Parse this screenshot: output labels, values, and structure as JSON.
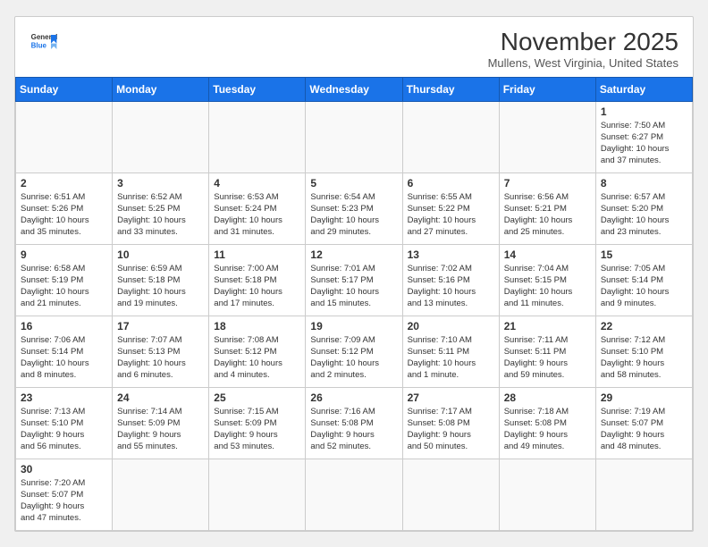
{
  "header": {
    "logo_line1": "General",
    "logo_line2": "Blue",
    "month": "November 2025",
    "location": "Mullens, West Virginia, United States"
  },
  "days_of_week": [
    "Sunday",
    "Monday",
    "Tuesday",
    "Wednesday",
    "Thursday",
    "Friday",
    "Saturday"
  ],
  "weeks": [
    [
      {
        "day": "",
        "info": ""
      },
      {
        "day": "",
        "info": ""
      },
      {
        "day": "",
        "info": ""
      },
      {
        "day": "",
        "info": ""
      },
      {
        "day": "",
        "info": ""
      },
      {
        "day": "",
        "info": ""
      },
      {
        "day": "1",
        "info": "Sunrise: 7:50 AM\nSunset: 6:27 PM\nDaylight: 10 hours\nand 37 minutes."
      }
    ],
    [
      {
        "day": "2",
        "info": "Sunrise: 6:51 AM\nSunset: 5:26 PM\nDaylight: 10 hours\nand 35 minutes."
      },
      {
        "day": "3",
        "info": "Sunrise: 6:52 AM\nSunset: 5:25 PM\nDaylight: 10 hours\nand 33 minutes."
      },
      {
        "day": "4",
        "info": "Sunrise: 6:53 AM\nSunset: 5:24 PM\nDaylight: 10 hours\nand 31 minutes."
      },
      {
        "day": "5",
        "info": "Sunrise: 6:54 AM\nSunset: 5:23 PM\nDaylight: 10 hours\nand 29 minutes."
      },
      {
        "day": "6",
        "info": "Sunrise: 6:55 AM\nSunset: 5:22 PM\nDaylight: 10 hours\nand 27 minutes."
      },
      {
        "day": "7",
        "info": "Sunrise: 6:56 AM\nSunset: 5:21 PM\nDaylight: 10 hours\nand 25 minutes."
      },
      {
        "day": "8",
        "info": "Sunrise: 6:57 AM\nSunset: 5:20 PM\nDaylight: 10 hours\nand 23 minutes."
      }
    ],
    [
      {
        "day": "9",
        "info": "Sunrise: 6:58 AM\nSunset: 5:19 PM\nDaylight: 10 hours\nand 21 minutes."
      },
      {
        "day": "10",
        "info": "Sunrise: 6:59 AM\nSunset: 5:18 PM\nDaylight: 10 hours\nand 19 minutes."
      },
      {
        "day": "11",
        "info": "Sunrise: 7:00 AM\nSunset: 5:18 PM\nDaylight: 10 hours\nand 17 minutes."
      },
      {
        "day": "12",
        "info": "Sunrise: 7:01 AM\nSunset: 5:17 PM\nDaylight: 10 hours\nand 15 minutes."
      },
      {
        "day": "13",
        "info": "Sunrise: 7:02 AM\nSunset: 5:16 PM\nDaylight: 10 hours\nand 13 minutes."
      },
      {
        "day": "14",
        "info": "Sunrise: 7:04 AM\nSunset: 5:15 PM\nDaylight: 10 hours\nand 11 minutes."
      },
      {
        "day": "15",
        "info": "Sunrise: 7:05 AM\nSunset: 5:14 PM\nDaylight: 10 hours\nand 9 minutes."
      }
    ],
    [
      {
        "day": "16",
        "info": "Sunrise: 7:06 AM\nSunset: 5:14 PM\nDaylight: 10 hours\nand 8 minutes."
      },
      {
        "day": "17",
        "info": "Sunrise: 7:07 AM\nSunset: 5:13 PM\nDaylight: 10 hours\nand 6 minutes."
      },
      {
        "day": "18",
        "info": "Sunrise: 7:08 AM\nSunset: 5:12 PM\nDaylight: 10 hours\nand 4 minutes."
      },
      {
        "day": "19",
        "info": "Sunrise: 7:09 AM\nSunset: 5:12 PM\nDaylight: 10 hours\nand 2 minutes."
      },
      {
        "day": "20",
        "info": "Sunrise: 7:10 AM\nSunset: 5:11 PM\nDaylight: 10 hours\nand 1 minute."
      },
      {
        "day": "21",
        "info": "Sunrise: 7:11 AM\nSunset: 5:11 PM\nDaylight: 9 hours\nand 59 minutes."
      },
      {
        "day": "22",
        "info": "Sunrise: 7:12 AM\nSunset: 5:10 PM\nDaylight: 9 hours\nand 58 minutes."
      }
    ],
    [
      {
        "day": "23",
        "info": "Sunrise: 7:13 AM\nSunset: 5:10 PM\nDaylight: 9 hours\nand 56 minutes."
      },
      {
        "day": "24",
        "info": "Sunrise: 7:14 AM\nSunset: 5:09 PM\nDaylight: 9 hours\nand 55 minutes."
      },
      {
        "day": "25",
        "info": "Sunrise: 7:15 AM\nSunset: 5:09 PM\nDaylight: 9 hours\nand 53 minutes."
      },
      {
        "day": "26",
        "info": "Sunrise: 7:16 AM\nSunset: 5:08 PM\nDaylight: 9 hours\nand 52 minutes."
      },
      {
        "day": "27",
        "info": "Sunrise: 7:17 AM\nSunset: 5:08 PM\nDaylight: 9 hours\nand 50 minutes."
      },
      {
        "day": "28",
        "info": "Sunrise: 7:18 AM\nSunset: 5:08 PM\nDaylight: 9 hours\nand 49 minutes."
      },
      {
        "day": "29",
        "info": "Sunrise: 7:19 AM\nSunset: 5:07 PM\nDaylight: 9 hours\nand 48 minutes."
      }
    ],
    [
      {
        "day": "30",
        "info": "Sunrise: 7:20 AM\nSunset: 5:07 PM\nDaylight: 9 hours\nand 47 minutes."
      },
      {
        "day": "",
        "info": ""
      },
      {
        "day": "",
        "info": ""
      },
      {
        "day": "",
        "info": ""
      },
      {
        "day": "",
        "info": ""
      },
      {
        "day": "",
        "info": ""
      },
      {
        "day": "",
        "info": ""
      }
    ]
  ]
}
